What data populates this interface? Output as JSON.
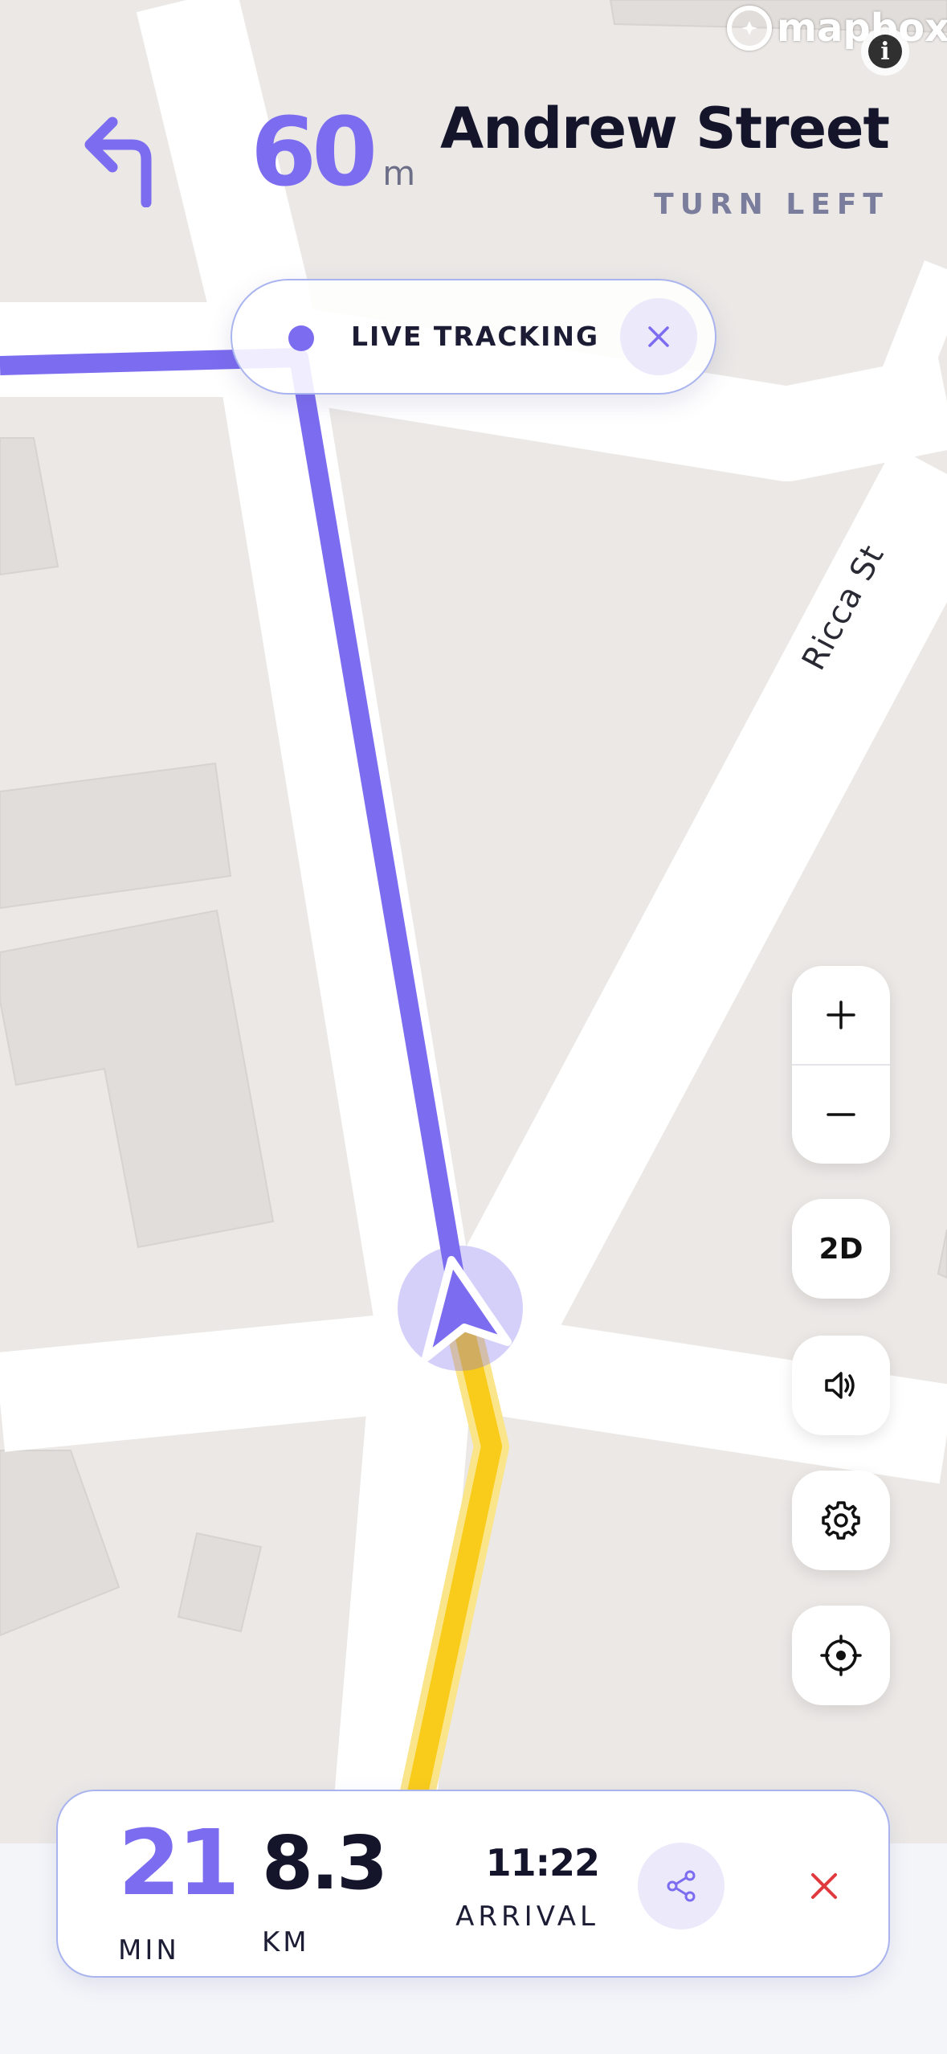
{
  "map": {
    "attribution": "mapbox",
    "info_icon": "info-icon",
    "street_label": "Ricca St",
    "colors": {
      "background": "#ebe8e6",
      "road": "#ffffff",
      "building": "#e0ddda",
      "route_ahead": "#7b6cf0",
      "route_travelled": "#f9cc1b"
    }
  },
  "instruction": {
    "arrow_icon": "turn-left-arrow-icon",
    "distance_value": "60",
    "distance_unit": "m",
    "street_name": "Andrew Street",
    "maneuver": "TURN LEFT"
  },
  "live_tracking": {
    "label": "LIVE TRACKING",
    "close_icon": "close-icon"
  },
  "controls": {
    "zoom_in_icon": "plus-icon",
    "zoom_out_icon": "minus-icon",
    "view_mode_label": "2D",
    "sound_icon": "speaker-icon",
    "settings_icon": "gear-icon",
    "recenter_icon": "crosshair-icon"
  },
  "trip": {
    "eta_value": "21",
    "eta_unit": "MIN",
    "distance_value": "8.3",
    "distance_unit": "KM",
    "arrival_time": "11:22",
    "arrival_label": "ARRIVAL",
    "share_icon": "share-icon",
    "end_icon": "end-navigation-icon"
  },
  "colors": {
    "accent": "#7b6cf0",
    "danger": "#e0393e",
    "text_dark": "#14142b",
    "text_muted": "#7a7d9c"
  }
}
